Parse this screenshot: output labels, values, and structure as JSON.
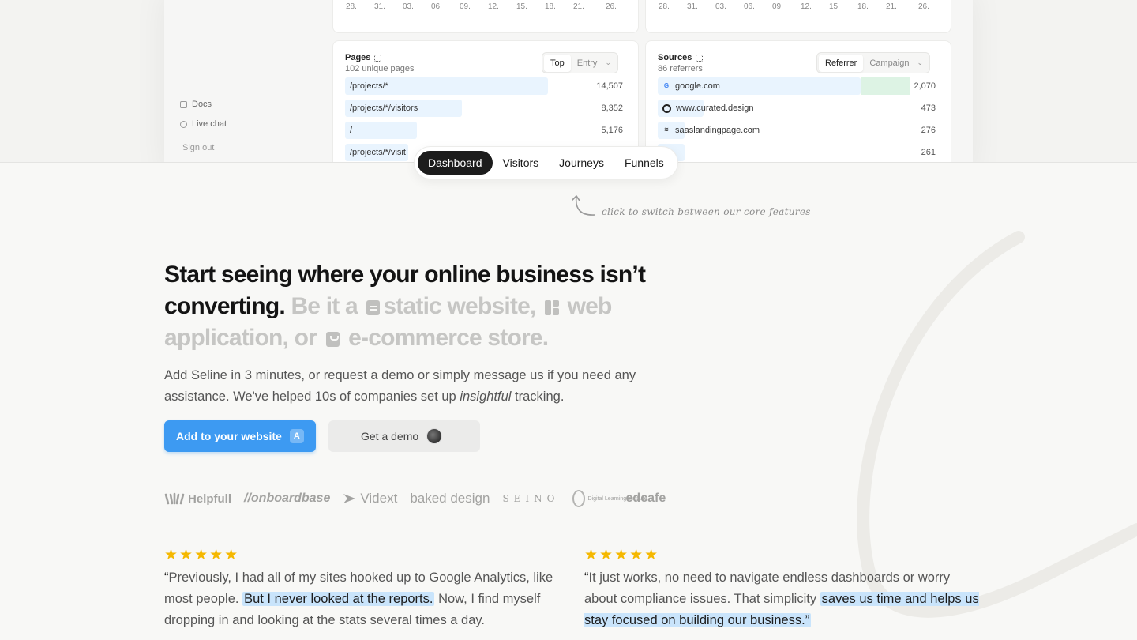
{
  "preview": {
    "sidebar": {
      "docs": "Docs",
      "live_chat": "Live chat",
      "sign_out": "Sign out"
    },
    "chart_dates_left": [
      "28.",
      "31.",
      "03.",
      "06.",
      "09.",
      "12.",
      "15.",
      "18.",
      "21.",
      "26."
    ],
    "chart_dates_right": [
      "28.",
      "31.",
      "03.",
      "06.",
      "09.",
      "12.",
      "15.",
      "18.",
      "21.",
      "26."
    ],
    "pages": {
      "title": "Pages",
      "subtitle": "102 unique pages",
      "tab_top": "Top",
      "tab_entry": "Entry",
      "rows": [
        {
          "label": "/projects/*",
          "value": "14,507",
          "share": 0.73
        },
        {
          "label": "/projects/*/visitors",
          "value": "8,352",
          "share": 0.42
        },
        {
          "label": "/",
          "value": "5,176",
          "share": 0.26
        },
        {
          "label": "/projects/*/visit",
          "value": "",
          "share": 0.2
        }
      ]
    },
    "sources": {
      "title": "Sources",
      "subtitle": "86 referrers",
      "tab_referrer": "Referrer",
      "tab_campaign": "Campaign",
      "rows": [
        {
          "label": "google.com",
          "value": "2,070",
          "icon": "google-icon",
          "share": 0.73
        },
        {
          "label": "www.curated.design",
          "value": "473",
          "icon": "curated-design-icon",
          "share": 0.17
        },
        {
          "label": "saaslandingpage.com",
          "value": "276",
          "icon": "saaslandingpage-icon",
          "share": 0.1
        },
        {
          "label": "",
          "value": "261",
          "icon": "",
          "share": 0.1
        }
      ]
    }
  },
  "tabs": [
    "Dashboard",
    "Visitors",
    "Journeys",
    "Funnels"
  ],
  "active_tab": "Dashboard",
  "hint": "click to switch between our core features",
  "hero": {
    "headline_strong": "Start seeing where your online business isn’t converting.",
    "headline_muted_1": "Be it a",
    "headline_muted_2": "static website,",
    "headline_muted_3": "web application, or",
    "headline_muted_4": "e-commerce store.",
    "sub_1": "Add Seline in 3 minutes, or request a demo or simply message us if you need any assistance. We've helped 10s of companies set up",
    "sub_em": "insightful",
    "sub_2": "tracking.",
    "cta_primary": "Add to your website",
    "cta_primary_kbd": "A",
    "cta_secondary": "Get a demo"
  },
  "logos": [
    "Helpfull",
    "//onboardbase",
    "Vidext",
    "baked design",
    "SEINO",
    "Digital Learning Institute",
    "edcafe"
  ],
  "testimonials": [
    {
      "stars": "★★★★★",
      "open": "“",
      "pre": "Previously, I had all of my sites hooked up to Google Analytics, like most people.",
      "highlight": "But I never looked at the reports.",
      "post": "Now, I find myself dropping in and looking at the stats several times a day."
    },
    {
      "stars": "★★★★★",
      "open": "“",
      "pre": "It just works, no need to navigate endless dashboards or worry about compliance issues. That simplicity",
      "highlight": "saves us time and helps us stay focused on building our business.”",
      "post": ""
    }
  ],
  "colors": {
    "accent": "#3d9af2",
    "highlight": "#c9e4fb",
    "star": "#f5b800"
  }
}
